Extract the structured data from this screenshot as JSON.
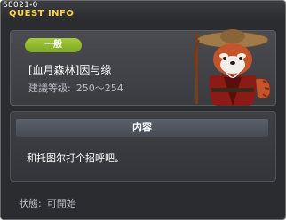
{
  "quest_id": "68021-0",
  "title": "QUEST INFO",
  "quest": {
    "type_badge": "一般",
    "name": "[血月森林]因与缘",
    "level_label": "建議等级:",
    "level_value": "250～254"
  },
  "content": {
    "header": "内容",
    "body": "和托图尔打个招呼吧。"
  },
  "status": {
    "label": "狀態:",
    "value": "可開始"
  },
  "colors": {
    "title": "#ffd34a",
    "badge": "#8fb52c"
  },
  "npc_icon": "red-panda-npc-icon"
}
